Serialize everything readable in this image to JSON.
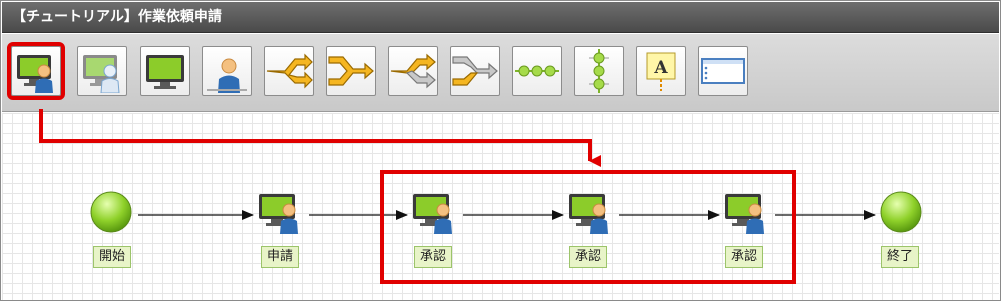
{
  "window": {
    "title": "【チュートリアル】作業依頼申請"
  },
  "toolbar": {
    "tools": [
      {
        "name": "user-task-tool",
        "icon": "monitor-person-icon"
      },
      {
        "name": "group-task-tool",
        "icon": "monitor-person-outline-icon"
      },
      {
        "name": "system-task-tool",
        "icon": "monitor-icon"
      },
      {
        "name": "manual-task-tool",
        "icon": "person-icon"
      },
      {
        "name": "split-and-tool",
        "icon": "split-merge-orange-icon"
      },
      {
        "name": "join-and-tool",
        "icon": "merge-orange-icon"
      },
      {
        "name": "split-or-tool",
        "icon": "split-grey-icon"
      },
      {
        "name": "join-or-tool",
        "icon": "merge-grey-icon"
      },
      {
        "name": "horizontal-line-tool",
        "icon": "horizontal-chain-icon"
      },
      {
        "name": "vertical-line-tool",
        "icon": "vertical-chain-icon"
      },
      {
        "name": "annotation-tool",
        "icon": "text-a-icon"
      },
      {
        "name": "note-tool",
        "icon": "note-box-icon"
      }
    ],
    "selected": "user-task-tool"
  },
  "flow": {
    "nodes": [
      {
        "id": "start",
        "type": "start",
        "label": "開始"
      },
      {
        "id": "apply",
        "type": "task",
        "label": "申請"
      },
      {
        "id": "approve1",
        "type": "task",
        "label": "承認"
      },
      {
        "id": "approve2",
        "type": "task",
        "label": "承認"
      },
      {
        "id": "approve3",
        "type": "task",
        "label": "承認"
      },
      {
        "id": "end",
        "type": "end",
        "label": "終了"
      }
    ]
  },
  "colors": {
    "highlight": "#e00000",
    "node_label_bg": "#e8f4c8",
    "node_green": "#7fc31c",
    "task_blue": "#2f6db5"
  }
}
